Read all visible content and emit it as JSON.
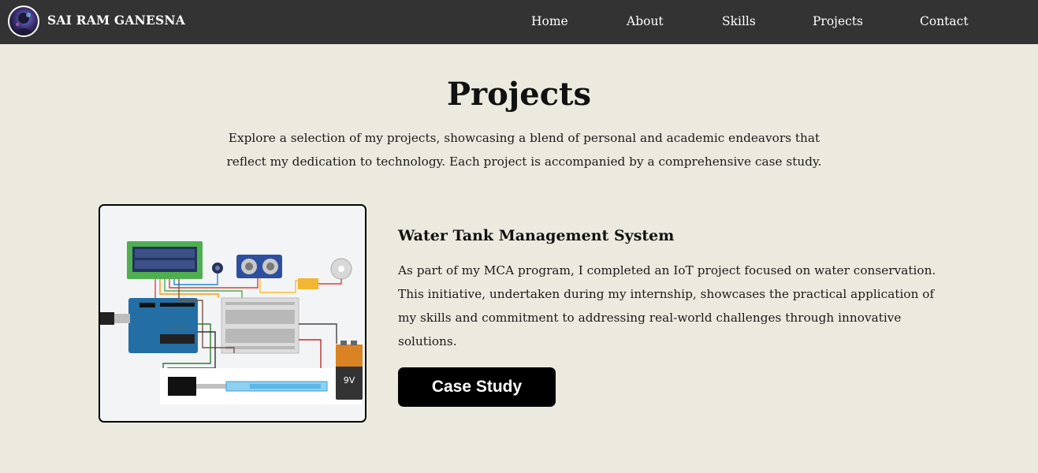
{
  "brand": {
    "name": "SAI RAM GANESNA",
    "avatar_icon": "profile-avatar"
  },
  "nav": {
    "items": [
      {
        "label": "Home"
      },
      {
        "label": "About"
      },
      {
        "label": "Skills"
      },
      {
        "label": "Projects"
      },
      {
        "label": "Contact"
      }
    ]
  },
  "page": {
    "title": "Projects",
    "intro_line1": "Explore a selection of my projects, showcasing a blend of personal and academic endeavors that",
    "intro_line2": "reflect my dedication to technology. Each project is accompanied by a comprehensive case study."
  },
  "projects": [
    {
      "title": "Water Tank Management System",
      "description_lines": [
        "As part of my MCA program, I completed an IoT project focused on water conservation.",
        "This initiative, undertaken during my internship, showcases the practical application of",
        "my skills and commitment to addressing real-world challenges through innovative",
        "solutions."
      ],
      "button_label": "Case Study",
      "image_battery_label": "9V"
    }
  ],
  "colors": {
    "navbar_bg": "#333333",
    "page_bg": "#ece9df",
    "button_bg": "#000000",
    "button_text": "#ffffff"
  }
}
